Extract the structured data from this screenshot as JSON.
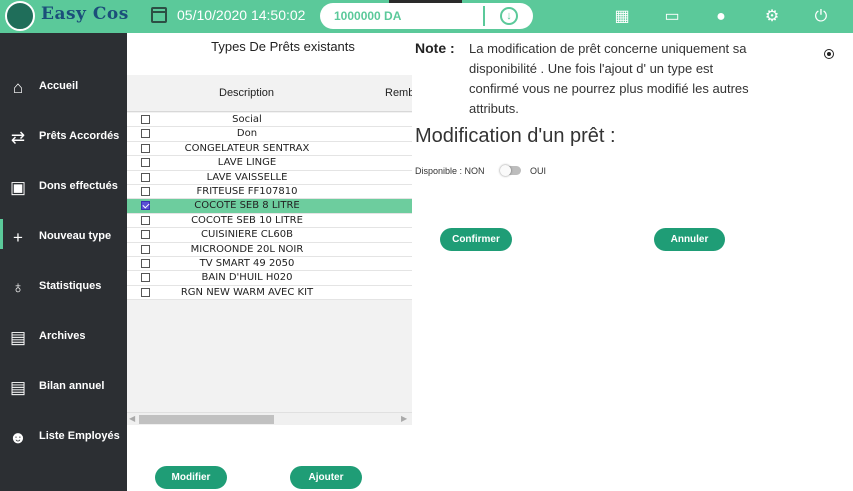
{
  "app": {
    "name": "Easy Cos"
  },
  "header": {
    "datetime": "05/10/2020 14:50:02",
    "amount": "1000000 DA",
    "icons": [
      "excel-icon",
      "card-icon",
      "user-icon",
      "settings-icon",
      "power-icon"
    ]
  },
  "sidebar": {
    "items": [
      {
        "label": "Accueil",
        "icon": "home-icon"
      },
      {
        "label": "Prêts Accordés",
        "icon": "handshake-icon"
      },
      {
        "label": "Dons effectués",
        "icon": "money-icon"
      },
      {
        "label": "Nouveau type",
        "icon": "plus-icon"
      },
      {
        "label": "Statistiques",
        "icon": "moneybag-icon"
      },
      {
        "label": "Archives",
        "icon": "archive-icon"
      },
      {
        "label": "Bilan annuel",
        "icon": "archive-icon"
      },
      {
        "label": "Liste Employés",
        "icon": "users-icon"
      }
    ]
  },
  "list": {
    "title": "Types De Prêts existants",
    "columns": {
      "description": "Description",
      "remb": "Remb"
    },
    "rows": [
      "Social",
      "Don",
      "CONGELATEUR SENTRAX",
      "LAVE LINGE",
      "LAVE VAISSELLE",
      "FRITEUSE FF107810",
      "COCOTE SEB 8 LITRE",
      "COCOTE SEB 10 LITRE",
      "CUISINIERE CL60B",
      "MICROONDE 20L NOIR",
      "TV SMART 49 2050",
      "BAIN D'HUIL H020",
      "RGN NEW WARM AVEC KIT"
    ],
    "selected_index": 6,
    "buttons": {
      "modify": "Modifier",
      "add": "Ajouter"
    }
  },
  "panel": {
    "note_label": "Note :",
    "note_text": "La modification de prêt concerne uniquement sa\ndisponibilité . Une fois l'ajout d' un type est\n confirmé vous ne pourrez plus modifié les autres\nattributs.",
    "title": "Modification d'un prêt :",
    "dispo_label": "Disponible : NON",
    "oui_label": "OUI",
    "confirm_label": "Confirmer",
    "cancel_label": "Annuler"
  },
  "colors": {
    "accent": "#5bc99a",
    "sidebar": "#2c2f33",
    "button": "#1f9d76"
  }
}
